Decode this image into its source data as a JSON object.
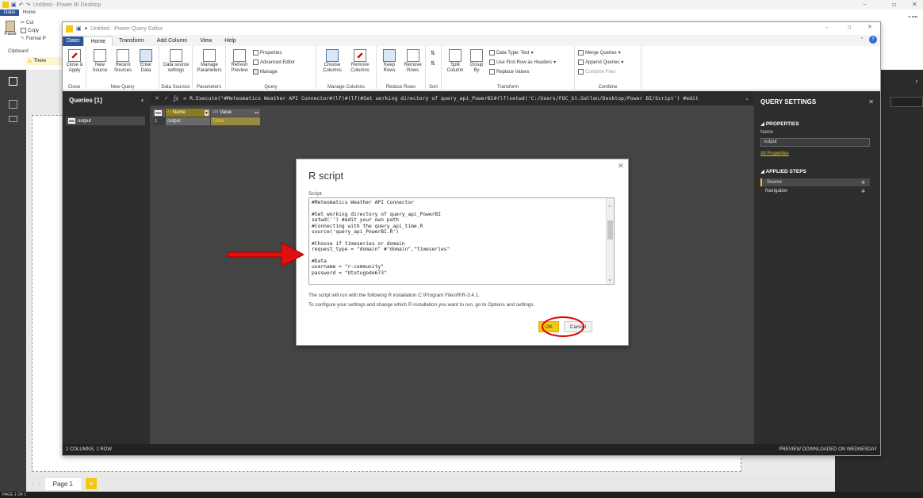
{
  "pbi": {
    "title": "Untitled - Power BI Desktop",
    "tabs": [
      "Datei",
      "Home"
    ],
    "ribbon": {
      "cut": "Cut",
      "copy": "Copy",
      "paste": "Paste",
      "format_painter": "Format P",
      "clipboard": "Clipboard",
      "warning": "There"
    },
    "right_user": "eldi",
    "page_tab": "Page 1",
    "status": "PAGE 1 OF 1"
  },
  "pq": {
    "title": "Untitled - Power Query Editor",
    "tabs": [
      "Datei",
      "Home",
      "Transform",
      "Add Column",
      "View",
      "Help"
    ],
    "ribbon": {
      "close_apply": "Close & Apply",
      "close": "Close",
      "new_source": "New Source",
      "recent_sources": "Recent Sources",
      "enter_data": "Enter Data",
      "new_query": "New Query",
      "data_source_settings": "Data source settings",
      "data_sources": "Data Sources",
      "manage_parameters": "Manage Parameters",
      "parameters": "Parameters",
      "refresh_preview": "Refresh Preview",
      "properties": "Properties",
      "advanced_editor": "Advanced Editor",
      "manage": "Manage",
      "query": "Query",
      "choose_columns": "Choose Columns",
      "remove_columns": "Remove Columns",
      "manage_columns": "Manage Columns",
      "keep_rows": "Keep Rows",
      "remove_rows": "Remove Rows",
      "reduce_rows": "Reduce Rows",
      "sort": "Sort",
      "split_column": "Split Column",
      "group_by": "Group By",
      "data_type": "Data Type: Text",
      "use_first_row": "Use First Row as Headers",
      "replace_values": "Replace Values",
      "transform": "Transform",
      "merge_queries": "Merge Queries",
      "append_queries": "Append Queries",
      "combine_files": "Combine Files",
      "combine": "Combine"
    },
    "queries_header": "Queries [1]",
    "query_item": "output",
    "formula": "= R.Execute(\"#Meteomatics Weather API Connector#(lf)#(lf)#Set working directory of query_api_PowerBI#(lf)setwd('C:/Users/FOC_St.Gallen/Desktop/Power BI/Script') #edit",
    "grid": {
      "headers": [
        "Name",
        "Value"
      ],
      "row_num": "1",
      "row": [
        "output",
        "Table"
      ]
    },
    "settings": {
      "title": "QUERY SETTINGS",
      "properties": "PROPERTIES",
      "name_label": "Name",
      "name_value": "output",
      "all_properties": "All Properties",
      "applied_steps": "APPLIED STEPS",
      "steps": [
        "Source",
        "Navigation"
      ]
    },
    "status_left": "2 COLUMNS, 1 ROW",
    "status_right": "PREVIEW DOWNLOADED ON WEDNESDAY"
  },
  "dialog": {
    "title": "R script",
    "script_label": "Script",
    "code": "#Meteomatics Weather API Connector\n\n#Set working directory of query_api_PowerBI\nsetwd('') #edit your own path\n#Connecting with the query_api_time.R\nsource('query_api_PowerBI.R')\n\n#Choose if timeseries or domain\nrequest_type = \"domain\" #\"domain\",\"timeseries\"\n\n#Data\nusername = \"r-community\"\npassword = \"Utotugode673\"",
    "note1": "The script will run with the following R installation C:\\Program Files\\R\\R-3.4.1.",
    "note2": "To configure your settings and change which R installation you want to run, go to Options and settings.",
    "ok": "OK",
    "cancel": "Cancel"
  }
}
